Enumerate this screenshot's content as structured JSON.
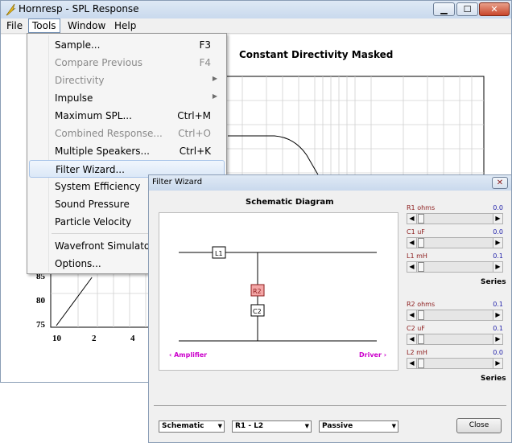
{
  "window": {
    "title": "Hornresp - SPL Response",
    "min_glyph": "▁",
    "max_glyph": "☐",
    "close_glyph": "✕"
  },
  "menubar": {
    "file": "File",
    "tools": "Tools",
    "window": "Window",
    "help": "Help"
  },
  "chart_title": "Constant Directivity   Masked",
  "tools_menu": {
    "items": [
      {
        "label": "Sample...",
        "shortcut": "F3",
        "enabled": true
      },
      {
        "label": "Compare Previous",
        "shortcut": "F4",
        "enabled": false
      },
      {
        "label": "Directivity",
        "shortcut": "",
        "enabled": false,
        "submenu": true
      },
      {
        "label": "Impulse",
        "shortcut": "",
        "enabled": true,
        "submenu": true
      },
      {
        "label": "Maximum SPL...",
        "shortcut": "Ctrl+M",
        "enabled": true
      },
      {
        "label": "Combined Response...",
        "shortcut": "Ctrl+O",
        "enabled": false
      },
      {
        "label": "Multiple Speakers...",
        "shortcut": "Ctrl+K",
        "enabled": true
      },
      {
        "label": "Filter Wizard...",
        "shortcut": "",
        "enabled": true,
        "highlighted": true
      },
      {
        "label": "System Efficiency",
        "shortcut": "",
        "enabled": true
      },
      {
        "label": "Sound Pressure",
        "shortcut": "",
        "enabled": true
      },
      {
        "label": "Particle Velocity",
        "shortcut": "",
        "enabled": true
      },
      {
        "label": "Wavefront Simulator...",
        "shortcut": "",
        "enabled": true
      },
      {
        "label": "Options...",
        "shortcut": "",
        "enabled": true
      }
    ],
    "arrow": "▶"
  },
  "chart_data": {
    "type": "line",
    "title": "",
    "xlabel": "",
    "ylabel": "",
    "x_tick_labels": [
      "10",
      "2",
      "4"
    ],
    "y_tick_labels": [
      "85",
      "80",
      "75"
    ],
    "series": [
      {
        "x": [
          11,
          20
        ],
        "y": [
          75,
          85
        ]
      }
    ],
    "grid": true
  },
  "wizard": {
    "title": "Filter Wizard",
    "close_glyph": "✕",
    "schematic_heading": "Schematic Diagram",
    "components": {
      "l1": "L1",
      "r2": "R2",
      "c2": "C2"
    },
    "amplifier_label": "‹  Amplifier",
    "driver_label": "Driver  ›",
    "params": [
      {
        "name": "R1  ohms",
        "value": "0.0"
      },
      {
        "name": "C1  uF",
        "value": "0.0"
      },
      {
        "name": "L1  mH",
        "value": "0.1"
      },
      {
        "name": "R2  ohms",
        "value": "0.1"
      },
      {
        "name": "C2  uF",
        "value": "0.1"
      },
      {
        "name": "L2  mH",
        "value": "0.0"
      }
    ],
    "series_label_1": "Series",
    "series_label_2": "Series",
    "slider_left": "◀",
    "slider_right": "▶",
    "combo_1": "Schematic",
    "combo_2": "R1 - L2",
    "combo_3": "Passive",
    "combo_arrow": "▼",
    "close_button": "Close"
  },
  "colors": {
    "accent_red": "#8b1a1a",
    "value_blue": "#2222aa",
    "magenta": "#cc00cc",
    "highlight_box": "#f4a6a6"
  }
}
